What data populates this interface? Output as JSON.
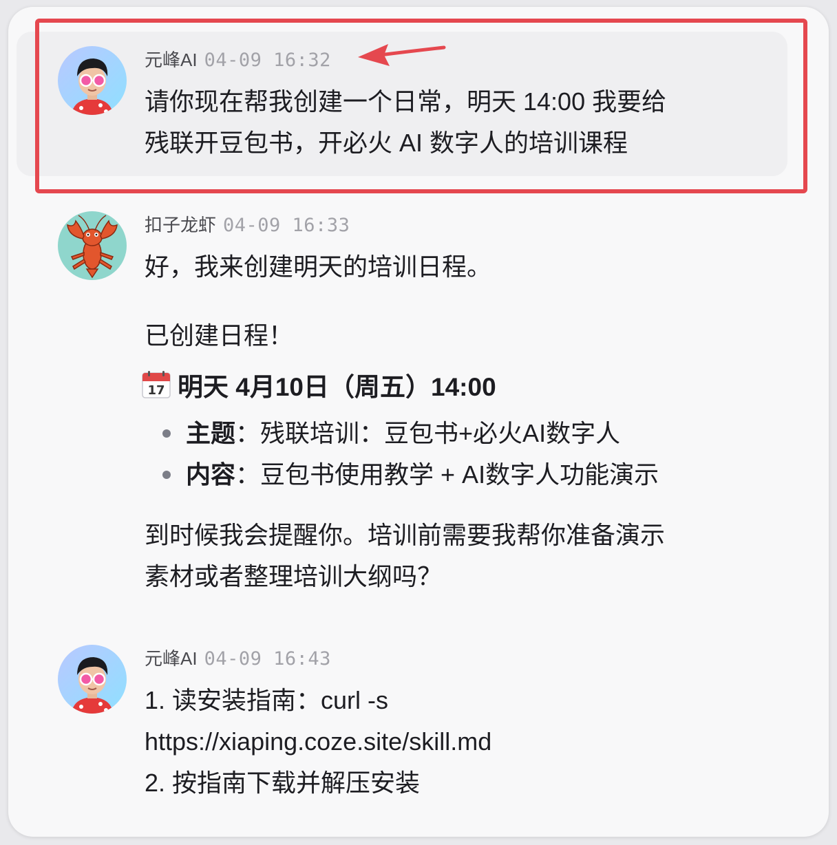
{
  "messages": [
    {
      "sender": "元峰AI",
      "time": "04-09 16:32",
      "lines": [
        "请你现在帮我创建一个日常，明天 14:00 我要给",
        "残联开豆包书，开必火 AI 数字人的培训课程"
      ],
      "avatar": "man-with-glasses-avatar"
    },
    {
      "sender": "扣子龙虾",
      "time": "04-09 16:33",
      "avatar": "lobster-avatar",
      "intro": "好，我来创建明天的培训日程。",
      "created": "已创建日程！",
      "schedule_icon": "calendar-icon",
      "schedule_title": "明天 4月10日（周五）14:00",
      "details": [
        {
          "label": "主题",
          "sep": "：",
          "value": "残联培训：豆包书+必火AI数字人"
        },
        {
          "label": "内容",
          "sep": "：",
          "value": "豆包书使用教学 + AI数字人功能演示"
        }
      ],
      "closing": [
        "到时候我会提醒你。培训前需要我帮你准备演示",
        "素材或者整理培训大纲吗？"
      ]
    },
    {
      "sender": "元峰AI",
      "time": "04-09 16:43",
      "avatar": "man-with-glasses-avatar",
      "lines": [
        "1. 读安装指南：curl -s",
        "https://xiaping.coze.site/skill.md",
        "2. 按指南下载并解压安装"
      ]
    }
  ],
  "colors": {
    "highlight_border": "#e5484f",
    "arrow": "#e5484f",
    "card_bg": "#f8f8f9",
    "selected_msg_bg": "#efeff1"
  }
}
